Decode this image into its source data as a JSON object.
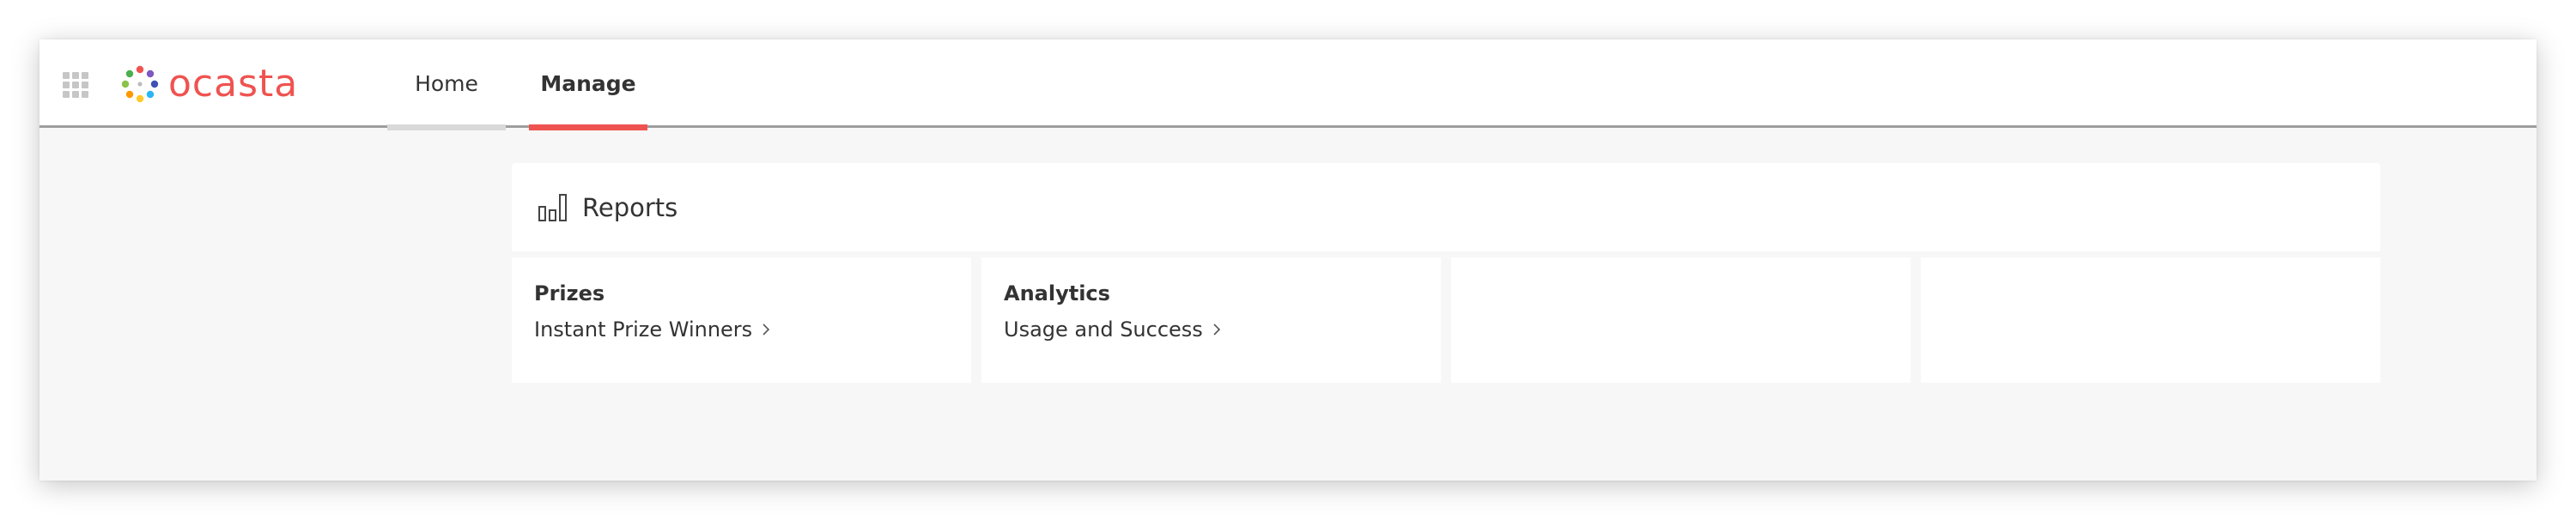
{
  "brand": {
    "name": "ocasta",
    "color": "#ef5350"
  },
  "nav": {
    "tabs": [
      {
        "label": "Home",
        "active": false
      },
      {
        "label": "Manage",
        "active": true
      }
    ]
  },
  "icons": {
    "app_grid": "app-grid-icon",
    "reports": "bar-chart-icon",
    "link_arrow": "chevron-right-icon"
  },
  "reports": {
    "title": "Reports",
    "sections": [
      {
        "title": "Prizes",
        "link": "Instant Prize Winners"
      },
      {
        "title": "Analytics",
        "link": "Usage and Success"
      }
    ]
  },
  "colors": {
    "accent": "#ef5350",
    "background": "#f7f7f7",
    "card": "#ffffff"
  }
}
